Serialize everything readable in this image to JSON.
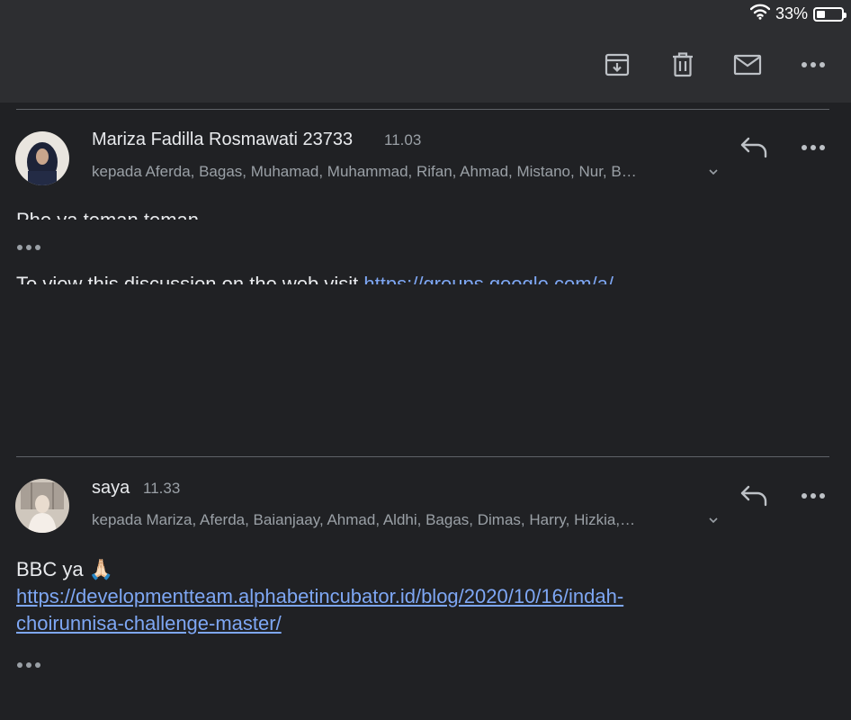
{
  "status": {
    "battery_text": "33%",
    "battery_level": 0.33
  },
  "toolbar": {
    "icons": [
      "archive-icon",
      "delete-icon",
      "mark-unread-icon",
      "more-icon"
    ]
  },
  "messages": [
    {
      "sender": "Mariza Fadilla Rosmawati 23733",
      "time": "11.03",
      "recipients": "kepada Aferda, Bagas, Muhamad, Muhammad, Rifan, Ahmad, Mistano, Nur, B…",
      "snippet": "Pho ya teman teman",
      "footer_prefix": "To view this discussion on the web visit ",
      "footer_link": "https://groups.google.com/a/"
    },
    {
      "sender": "saya",
      "time": "11.33",
      "recipients": "kepada Mariza, Aferda, Baianjaay, Ahmad, Aldhi, Bagas, Dimas, Harry, Hizkia,…",
      "body_text": "BBC ya 🙏🏻",
      "link_line1": "https://developmentteam.alphabetincubator.id/blog/2020/10/16/indah-",
      "link_line2": "choirunnisa-challenge-master/"
    }
  ],
  "colors": {
    "background": "#202124",
    "topbar": "#2d2e31",
    "link": "#7ea7f4",
    "secondary_text": "#9aa0a6"
  }
}
